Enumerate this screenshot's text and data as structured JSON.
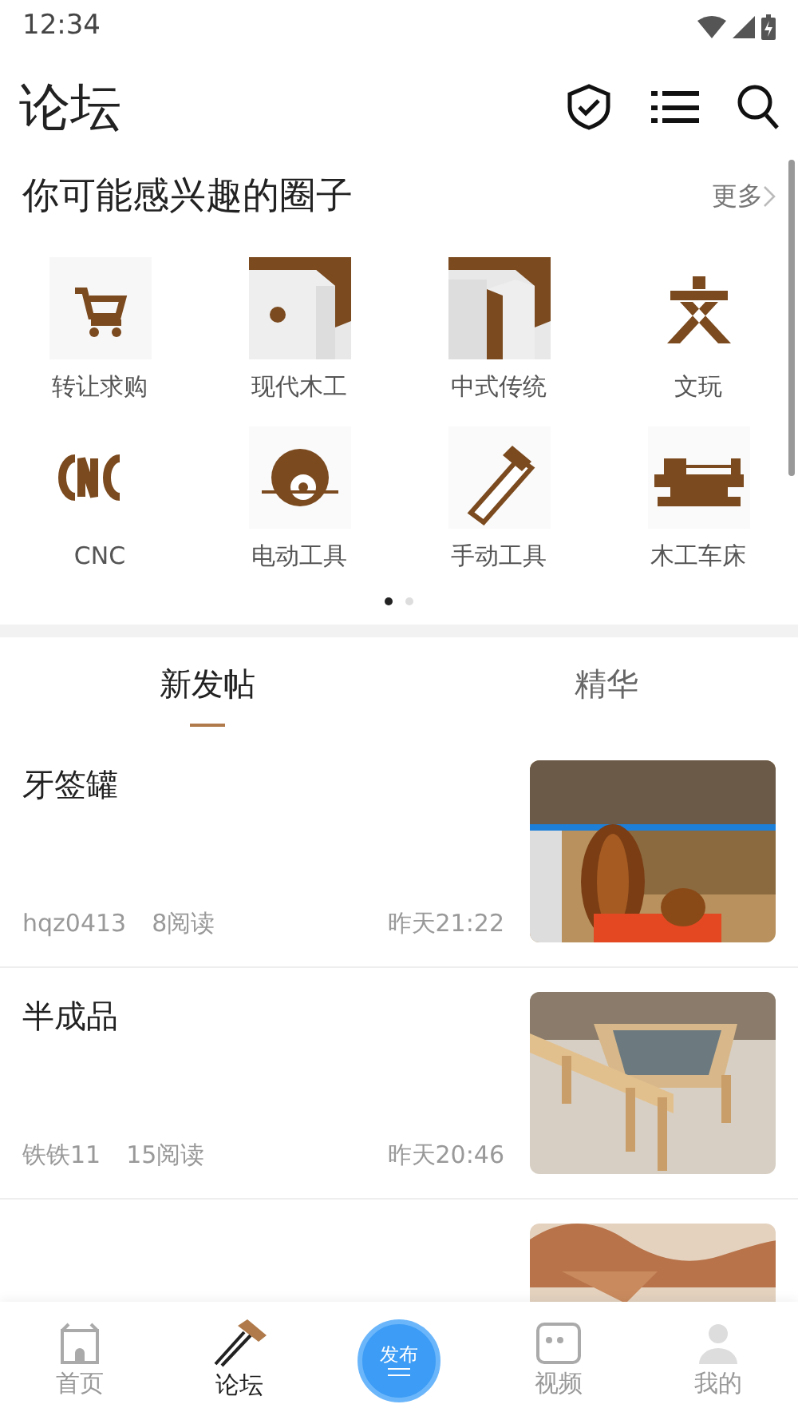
{
  "status_bar": {
    "time": "12:34"
  },
  "header": {
    "title": "论坛"
  },
  "circles": {
    "title": "你可能感兴趣的圈子",
    "more": "更多",
    "items": [
      {
        "label": "转让求购"
      },
      {
        "label": "现代木工"
      },
      {
        "label": "中式传统"
      },
      {
        "label": "文玩"
      },
      {
        "label": "CNC"
      },
      {
        "label": "电动工具"
      },
      {
        "label": "手动工具"
      },
      {
        "label": "木工车床"
      }
    ],
    "pages": [
      {
        "selected": true
      },
      {
        "selected": false
      }
    ]
  },
  "tabs": [
    {
      "label": "新发帖",
      "selected": true
    },
    {
      "label": "精华",
      "selected": false
    }
  ],
  "posts": [
    {
      "title": "牙签罐",
      "author": "hqz0413",
      "reads": "8阅读",
      "time": "昨天21:22"
    },
    {
      "title": "半成品",
      "author": "铁铁11",
      "reads": "15阅读",
      "time": "昨天20:46"
    }
  ],
  "bottom_nav": [
    {
      "kind": "home",
      "label": "首页",
      "selected": false
    },
    {
      "kind": "forum",
      "label": "论坛",
      "selected": true
    },
    {
      "kind": "publish",
      "label": "发布",
      "selected": false
    },
    {
      "kind": "video",
      "label": "视频",
      "selected": false
    },
    {
      "kind": "mine",
      "label": "我的",
      "selected": false
    }
  ]
}
